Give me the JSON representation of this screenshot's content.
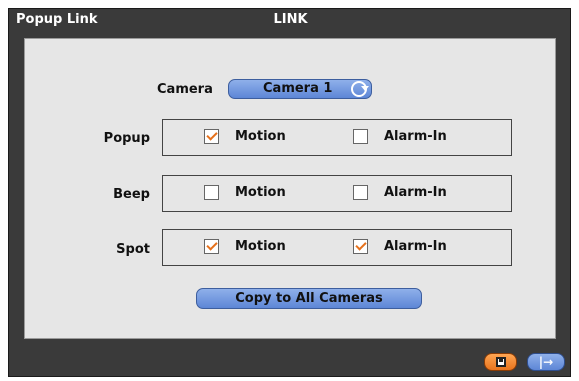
{
  "window": {
    "left_title": "Popup Link",
    "center_title": "LINK"
  },
  "camera": {
    "label": "Camera",
    "selected": "Camera 1"
  },
  "rows": [
    {
      "label": "Popup",
      "options": [
        {
          "label": "Motion",
          "checked": true
        },
        {
          "label": "Alarm-In",
          "checked": false
        }
      ]
    },
    {
      "label": "Beep",
      "options": [
        {
          "label": "Motion",
          "checked": false
        },
        {
          "label": "Alarm-In",
          "checked": false
        }
      ]
    },
    {
      "label": "Spot",
      "options": [
        {
          "label": "Motion",
          "checked": true
        },
        {
          "label": "Alarm-In",
          "checked": true
        }
      ]
    }
  ],
  "copy_button": {
    "label": "Copy to All Cameras"
  },
  "footer": {
    "save_icon": "save-icon",
    "exit_icon": "exit-icon",
    "exit_glyph": "|→"
  },
  "colors": {
    "window_bg": "#3a3a3a",
    "panel_bg": "#e6e6e6",
    "accent_blue": "#6f95dd",
    "accent_orange": "#f58a2b",
    "check_mark": "#e6711c"
  }
}
